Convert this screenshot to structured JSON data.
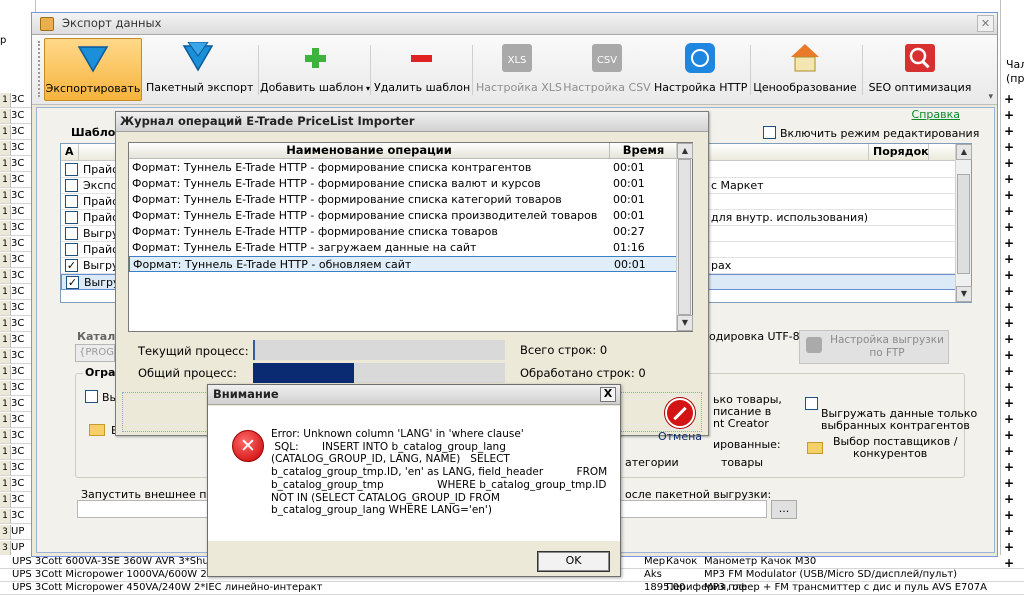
{
  "bg": {
    "left_header": "р",
    "left_rows": [
      "3C",
      "3C",
      "3C",
      "3C",
      "3C",
      "3C",
      "3C",
      "3C",
      "3C",
      "3C",
      "3C",
      "3C",
      "3C",
      "3C",
      "3C",
      "3C",
      "3C",
      "3C",
      "3C",
      "3C",
      "3C",
      "3C",
      "3C",
      "3C",
      "3C",
      "3C",
      "3C",
      "UP",
      "UP"
    ],
    "left_row_nums": [
      "1",
      "1",
      "1",
      "1",
      "1",
      "1",
      "1",
      "1",
      "1",
      "1",
      "1",
      "1",
      "1",
      "1",
      "1",
      "1",
      "1",
      "1",
      "1",
      "1",
      "1",
      "1",
      "1",
      "1",
      "1",
      "1",
      "1",
      "3",
      "3"
    ],
    "right_header_1": "Чал",
    "right_header_2": "(пр",
    "plus": "+",
    "bottom_rows": [
      {
        "a": "UPS 3Cott 600VA-3SE 360W AVR 3*Shuk",
        "b": "Мер",
        "c": "Качок",
        "d": "Манометр Качок М30"
      },
      {
        "a": "UPS 3Cott Micropower 1000VA/600W 2*",
        "b": "Aks",
        "c": "",
        "d": "MP3 FM Modulator (USB/Micro SD/дисплей/пульт)"
      },
      {
        "a": "UPS 3Cott Micropower 450VA/240W 2*IEC линейно-интеракт",
        "b": "1895.00",
        "c": "Периферия, оф",
        "d": "MP3 плеер + FM трансмиттер с дис и пуль AVS E707A"
      }
    ]
  },
  "main_window": {
    "title": "Экспорт данных",
    "toolbar": [
      {
        "label": "Экспортировать",
        "icon": "export-arrow-icon",
        "disabled": false,
        "selected": true
      },
      {
        "label": "Пакетный экспорт",
        "icon": "batch-export-icon",
        "disabled": false,
        "selected": false
      },
      {
        "label": "Добавить шаблон",
        "icon": "add-plus-icon",
        "disabled": false,
        "selected": false
      },
      {
        "label": "Удалить шаблон",
        "icon": "remove-minus-icon",
        "disabled": false,
        "selected": false
      },
      {
        "label": "Настройка XLS",
        "icon": "xls-icon",
        "disabled": true,
        "selected": false
      },
      {
        "label": "Настройка CSV",
        "icon": "csv-icon",
        "disabled": true,
        "selected": false
      },
      {
        "label": "Настройка HTTP",
        "icon": "http-icon",
        "disabled": false,
        "selected": false
      },
      {
        "label": "Ценообразование",
        "icon": "pricing-house-icon",
        "disabled": false,
        "selected": false
      },
      {
        "label": "SEO оптимизация",
        "icon": "seo-icon",
        "disabled": false,
        "selected": false
      }
    ],
    "help_link": "Справка",
    "templates_label": "Шаблон",
    "edit_mode_label": "Включить режим редактирования",
    "grid": {
      "columns": [
        "А",
        "Порядок"
      ],
      "rows": [
        {
          "checked": false,
          "name": "Прайс",
          "right": ""
        },
        {
          "checked": false,
          "name": "Экспор",
          "right": "с Маркет"
        },
        {
          "checked": false,
          "name": "Прайс",
          "right": ""
        },
        {
          "checked": false,
          "name": "Прайс",
          "right": "для внутр. использования)"
        },
        {
          "checked": false,
          "name": "Выгру",
          "right": ""
        },
        {
          "checked": false,
          "name": "Прайс",
          "right": ""
        },
        {
          "checked": true,
          "name": "Выгру",
          "right": "рах"
        },
        {
          "checked": true,
          "name": "Выгру",
          "right": ""
        }
      ]
    },
    "catalog_label": "Катало",
    "catalog_path": "{PROG",
    "encoding_label": "одировка UTF-8",
    "ftp_button": "Настройка выгрузки по FTP",
    "restrict_title": "Огра",
    "restrict_left_1": "Вы",
    "restrict_left_2": "Вы",
    "restrict_r1_lines": [
      "ько товары,",
      "писание в",
      "nt Creator"
    ],
    "restrict_r2_lines": [
      "Выгружать данные только",
      "выбранных контрагентов"
    ],
    "restrict_r3": "ированные:",
    "restrict_r3b": "товары",
    "restrict_r3c": "атегории",
    "suppliers_lines": [
      "Выбор поставщиков /",
      "конкурентов"
    ],
    "ext_label": "Запустить внешнее прил",
    "after_batch_label": "осле пакетной выгрузки:",
    "browse": "..."
  },
  "log_window": {
    "title": "Журнал операций E-Trade PriceList Importer",
    "col_op": "Наименование операции",
    "col_time": "Время",
    "rows": [
      {
        "op": "Формат: Туннель E-Trade HTTP - формирование списка контрагентов",
        "time": "00:01"
      },
      {
        "op": "Формат: Туннель E-Trade HTTP - формирование списка валют и курсов",
        "time": "00:01"
      },
      {
        "op": "Формат: Туннель E-Trade HTTP - формирование списка категорий товаров",
        "time": "00:01"
      },
      {
        "op": "Формат: Туннель E-Trade HTTP - формирование списка производителей товаров",
        "time": "00:01"
      },
      {
        "op": "Формат: Туннель E-Trade HTTP - формирование списка товаров",
        "time": "00:27"
      },
      {
        "op": "Формат: Туннель E-Trade HTTP - загружаем данные на сайт",
        "time": "01:16"
      },
      {
        "op": "Формат: Туннель E-Trade HTTP - обновляем сайт",
        "time": "00:01"
      }
    ],
    "current_label": "Текущий процесс:",
    "current_progress": 0.01,
    "total_label": "Общий процесс:",
    "total_progress": 0.4,
    "rows_total": "Всего строк: 0",
    "rows_done": "Обработано строк: 0",
    "cancel": "Отмена"
  },
  "error_dialog": {
    "title": "Внимание",
    "message": "Error: Unknown column 'LANG' in 'where clause'\n SQL:       INSERT INTO b_catalog_group_lang\n(CATALOG_GROUP_ID, LANG, NAME)   SELECT\nb_catalog_group_tmp.ID, 'en' as LANG, field_header          FROM\nb_catalog_group_tmp                WHERE b_catalog_group_tmp.ID\nNOT IN (SELECT CATALOG_GROUP_ID FROM\nb_catalog_group_lang WHERE LANG='en')",
    "ok": "OK",
    "close": "X"
  }
}
